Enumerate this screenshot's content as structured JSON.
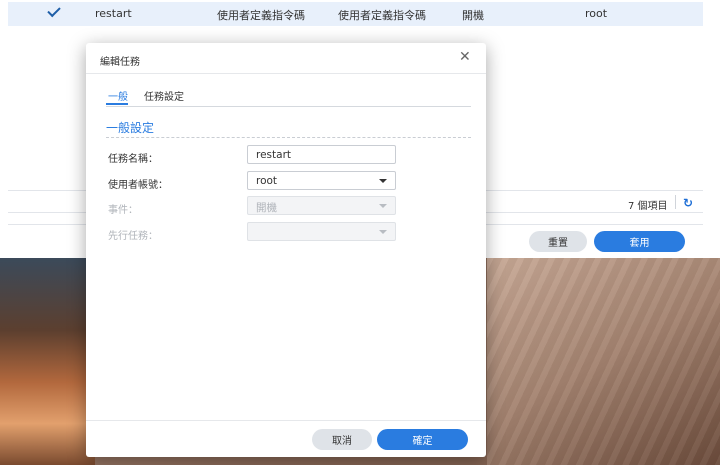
{
  "background_table": {
    "row": {
      "name": "restart",
      "type": "使用者定義指令碼",
      "action": "使用者定義指令碼",
      "event": "開機",
      "user": "root"
    },
    "item_count": "7 個項目",
    "reset_label": "重置",
    "apply_label": "套用"
  },
  "dialog": {
    "title": "編輯任務",
    "tabs": [
      {
        "label": "一般",
        "active": true
      },
      {
        "label": "任務設定",
        "active": false
      }
    ],
    "section_title": "一般設定",
    "fields": {
      "task_name": {
        "label": "任務名稱：",
        "value": "restart"
      },
      "user_account": {
        "label": "使用者帳號：",
        "value": "root"
      },
      "event": {
        "label": "事件：",
        "value": "開機",
        "disabled": true
      },
      "pre_task": {
        "label": "先行任務：",
        "value": "",
        "disabled": true
      }
    },
    "cancel_label": "取消",
    "ok_label": "確定"
  },
  "colors": {
    "accent": "#2a7ce0",
    "selected_row": "#e8f0fb"
  },
  "icons": {
    "check": "check-icon",
    "close": "close-icon",
    "refresh": "refresh-icon",
    "dropdown": "chevron-down-icon"
  }
}
